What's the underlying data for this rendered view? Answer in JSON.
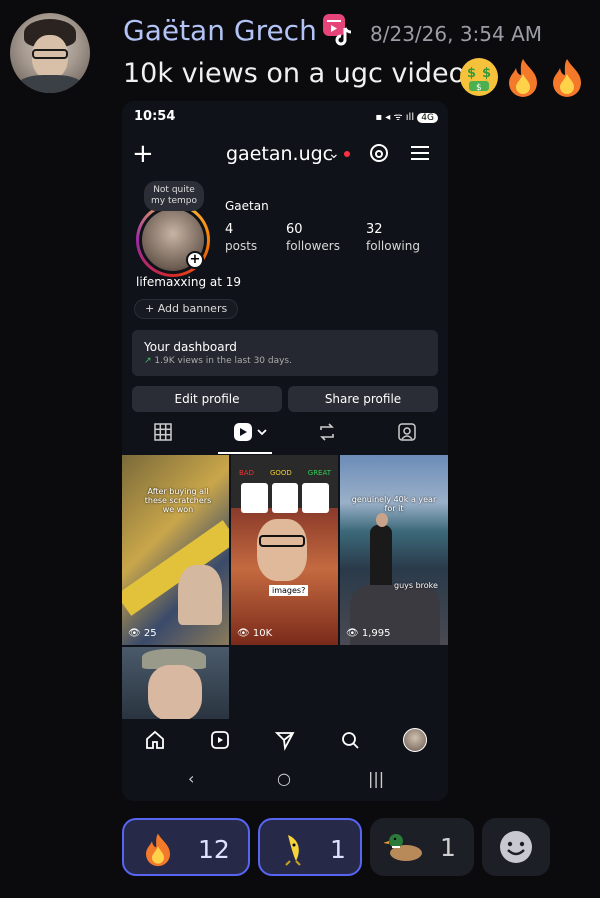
{
  "message": {
    "author": "Gaëtan Grech",
    "timestamp": "8/23/26, 3:54 AM",
    "text": "10k views on a ugc video",
    "inline_emojis": [
      "money-mouth-face",
      "fire",
      "fire"
    ]
  },
  "phone": {
    "status_time": "10:54",
    "battery": "4G",
    "username": "gaetan.ugc",
    "note": "Not quite my tempo",
    "display_name": "Gaetan",
    "stats": [
      {
        "count": "4",
        "label": "posts"
      },
      {
        "count": "60",
        "label": "followers"
      },
      {
        "count": "32",
        "label": "following"
      }
    ],
    "bio": "lifemaxxing at 19",
    "add_banners": "+ Add banners",
    "dashboard": {
      "title": "Your dashboard",
      "subtitle": "1.9K views in the last 30 days."
    },
    "edit_profile": "Edit profile",
    "share_profile": "Share profile",
    "grid": [
      {
        "caption": "After buying all these scratchers we won",
        "views": "25"
      },
      {
        "caption": "images?",
        "views": "10K",
        "labels": [
          "BAD",
          "GOOD",
          "GREAT"
        ]
      },
      {
        "caption": "genuinely 40k a year for it",
        "caption2": "guys broke",
        "views": "1,995"
      },
      {
        "caption": "",
        "views": ""
      }
    ]
  },
  "reactions": [
    {
      "icon": "fire",
      "count": "12",
      "active": true
    },
    {
      "icon": "banana-dancing",
      "count": "1",
      "active": true
    },
    {
      "icon": "duck",
      "count": "1",
      "active": false
    },
    {
      "icon": "add-reaction",
      "count": "",
      "active": false
    }
  ],
  "colors": {
    "background": "#0b0b0e",
    "author": "#b3c3f5",
    "accent": "#5865f2",
    "ig_notification": "#ff3040"
  }
}
